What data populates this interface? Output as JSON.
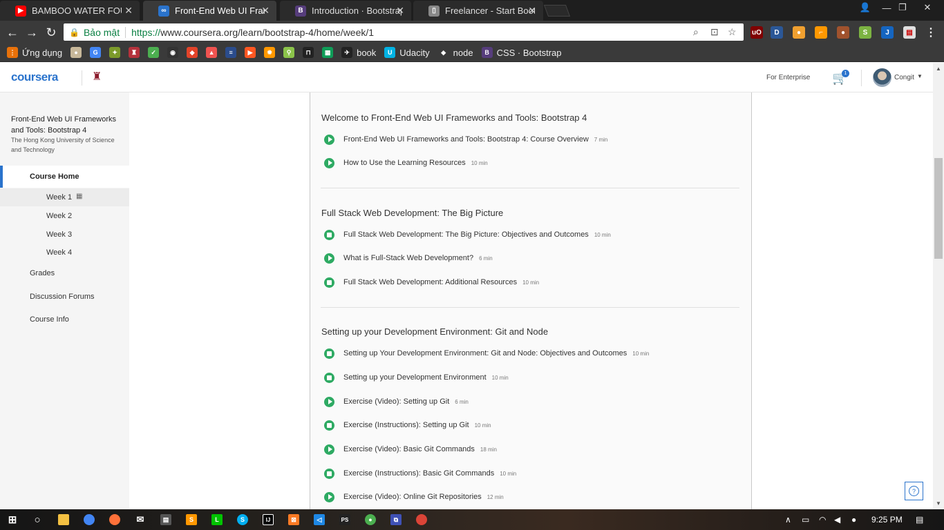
{
  "browser": {
    "tabs": [
      {
        "title": "BAMBOO WATER FOUNT",
        "icon": "youtube-icon",
        "color": "#ff0000",
        "glyph": "▶"
      },
      {
        "title": "Front-End Web UI Frame",
        "icon": "coursera-icon",
        "color": "#2a73cc",
        "glyph": "∞",
        "active": true
      },
      {
        "title": "Introduction · Bootstrap",
        "icon": "bootstrap-icon",
        "color": "#563d7c",
        "glyph": "B"
      },
      {
        "title": "Freelancer - Start Bootstr",
        "icon": "document-icon",
        "color": "#888888",
        "glyph": "▯"
      }
    ],
    "security_label": "Bảo mật",
    "url_scheme": "https://",
    "url_rest": "www.coursera.org/learn/bootstrap-4/home/week/1",
    "bookmarks": [
      {
        "label": "Ứng dụng",
        "icon": "apps-grid-icon",
        "color": "#e8710a",
        "glyph": "⋮"
      },
      {
        "label": "",
        "icon": "globe-icon",
        "color": "#c8b89a",
        "glyph": "●"
      },
      {
        "label": "",
        "icon": "google-translate-icon",
        "color": "#4285f4",
        "glyph": "G"
      },
      {
        "label": "",
        "icon": "puzzle-icon",
        "color": "#7c9a2a",
        "glyph": "✦"
      },
      {
        "label": "",
        "icon": "crest-icon",
        "color": "#b5323c",
        "glyph": "♜"
      },
      {
        "label": "",
        "icon": "check-icon",
        "color": "#4caf50",
        "glyph": "✓"
      },
      {
        "label": "",
        "icon": "camera-icon",
        "color": "#333333",
        "glyph": "◉"
      },
      {
        "label": "",
        "icon": "gitlab-icon",
        "color": "#e24329",
        "glyph": "◆"
      },
      {
        "label": "",
        "icon": "fire-icon",
        "color": "#ef5350",
        "glyph": "▲"
      },
      {
        "label": "",
        "icon": "stack-icon",
        "color": "#2b4c8c",
        "glyph": "≡"
      },
      {
        "label": "",
        "icon": "play-icon",
        "color": "#ff5722",
        "glyph": "▶"
      },
      {
        "label": "",
        "icon": "flame-icon",
        "color": "#ff9800",
        "glyph": "✹"
      },
      {
        "label": "",
        "icon": "map-pin-icon",
        "color": "#8bc34a",
        "glyph": "⚲"
      },
      {
        "label": "",
        "icon": "gate-icon",
        "color": "#222222",
        "glyph": "⊓"
      },
      {
        "label": "",
        "icon": "sheets-icon",
        "color": "#0f9d58",
        "glyph": "▦"
      },
      {
        "label": "book",
        "icon": "bird-icon",
        "color": "#222222",
        "glyph": "✈"
      },
      {
        "label": "Udacity",
        "icon": "udacity-icon",
        "color": "#02b3e4",
        "glyph": "U"
      },
      {
        "label": "node",
        "icon": "node-icon",
        "color": "#3a3a3a",
        "glyph": "◆"
      },
      {
        "label": "CSS · Bootstrap",
        "icon": "bootstrap-icon",
        "color": "#563d7c",
        "glyph": "B"
      }
    ]
  },
  "header": {
    "logo": "coursera",
    "enterprise": "For Enterprise",
    "cart_count": "1",
    "username": "Congit"
  },
  "sidebar": {
    "course_title": "Front-End Web UI Frameworks and Tools: Bootstrap 4",
    "university": "The Hong Kong University of Science and Technology",
    "home": "Course Home",
    "weeks": [
      "Week 1",
      "Week 2",
      "Week 3",
      "Week 4"
    ],
    "grades": "Grades",
    "forums": "Discussion Forums",
    "info": "Course Info"
  },
  "sections": [
    {
      "title": "Welcome to Front-End Web UI Frameworks and Tools: Bootstrap 4",
      "items": [
        {
          "type": "video",
          "name": "Front-End Web UI Frameworks and Tools: Bootstrap 4: Course Overview",
          "duration": "7 min"
        },
        {
          "type": "video",
          "name": "How to Use the Learning Resources",
          "duration": "10 min"
        }
      ]
    },
    {
      "title": "Full Stack Web Development: The Big Picture",
      "items": [
        {
          "type": "reading",
          "name": "Full Stack Web Development: The Big Picture: Objectives and Outcomes",
          "duration": "10 min"
        },
        {
          "type": "video",
          "name": "What is Full-Stack Web Development?",
          "duration": "6 min"
        },
        {
          "type": "reading",
          "name": "Full Stack Web Development: Additional Resources",
          "duration": "10 min"
        }
      ]
    },
    {
      "title": "Setting up your Development Environment: Git and Node",
      "items": [
        {
          "type": "reading",
          "name": "Setting up Your Development Environment: Git and Node: Objectives and Outcomes",
          "duration": "10 min"
        },
        {
          "type": "reading",
          "name": "Setting up your Development Environment",
          "duration": "10 min"
        },
        {
          "type": "video",
          "name": "Exercise (Video): Setting up Git",
          "duration": "6 min"
        },
        {
          "type": "reading",
          "name": "Exercise (Instructions): Setting up Git",
          "duration": "10 min"
        },
        {
          "type": "video",
          "name": "Exercise (Video): Basic Git Commands",
          "duration": "18 min"
        },
        {
          "type": "reading",
          "name": "Exercise (Instructions): Basic Git Commands",
          "duration": "10 min"
        },
        {
          "type": "video",
          "name": "Exercise (Video): Online Git Repositories",
          "duration": "12 min"
        }
      ]
    }
  ],
  "taskbar": {
    "apps": [
      {
        "icon": "windows-start-icon",
        "color": "#1e1e1e",
        "glyph": "⊞"
      },
      {
        "icon": "cortana-icon",
        "color": "#1e1e1e",
        "glyph": "○"
      },
      {
        "icon": "file-explorer-icon",
        "color": "#f3c042",
        "glyph": "▬"
      },
      {
        "icon": "chrome-icon",
        "color": "#4285f4",
        "glyph": "◎"
      },
      {
        "icon": "firefox-icon",
        "color": "#ff7139",
        "glyph": "◉"
      },
      {
        "icon": "mail-icon",
        "color": "#1e1e1e",
        "glyph": "✉"
      },
      {
        "icon": "store-icon",
        "color": "#555555",
        "glyph": "▤"
      },
      {
        "icon": "sublime-icon",
        "color": "#ff9800",
        "glyph": "S"
      },
      {
        "icon": "line-icon",
        "color": "#00c300",
        "glyph": "L"
      },
      {
        "icon": "skype-icon",
        "color": "#00aff0",
        "glyph": "S"
      },
      {
        "icon": "intellij-icon",
        "color": "#000000",
        "glyph": "IJ"
      },
      {
        "icon": "xampp-icon",
        "color": "#fb7a24",
        "glyph": "⊠"
      },
      {
        "icon": "vscode-icon",
        "color": "#1e88e5",
        "glyph": "◁"
      },
      {
        "icon": "phpstorm-icon",
        "color": "#222222",
        "glyph": "PS"
      },
      {
        "icon": "mongodb-icon",
        "color": "#4caf50",
        "glyph": "●"
      },
      {
        "icon": "network-tool-icon",
        "color": "#3f51b5",
        "glyph": "⧉"
      },
      {
        "icon": "chrome-icon-2",
        "color": "#db4437",
        "glyph": "◎"
      }
    ],
    "time": "9:25 PM"
  }
}
